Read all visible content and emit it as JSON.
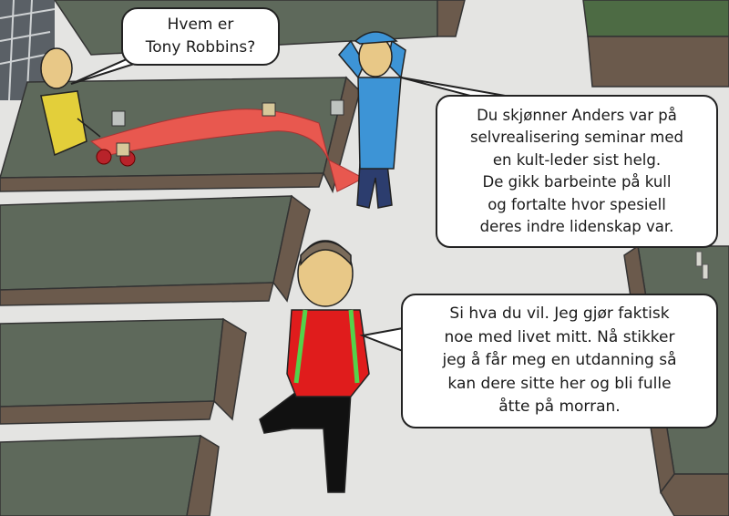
{
  "bubbles": {
    "first": "Hvem er\nTony Robbins?",
    "second": "Du skjønner Anders var på\nselvrealisering seminar med\nen kult-leder sist helg.\nDe gikk barbeinte på kull\nog fortalte hvor spesiell\nderes indre lidenskap var.",
    "third": "Si hva du vil. Jeg gjør faktisk\nnoe med livet mitt. Nå stikker\njeg å får meg en utdanning så\nkan dere sitte her og bli fulle\nåtte på morran."
  },
  "colors": {
    "floor": "#e4e4e2",
    "table_top": "#5e695b",
    "table_edge": "#6b5a4c",
    "green_table": "#4d6b44",
    "yellow_shirt": "#e3cf3a",
    "blue_shirt": "#3d94d6",
    "red_shirt": "#e01c1c",
    "scarf": "#e8584f",
    "backpack": "#55d24a"
  }
}
